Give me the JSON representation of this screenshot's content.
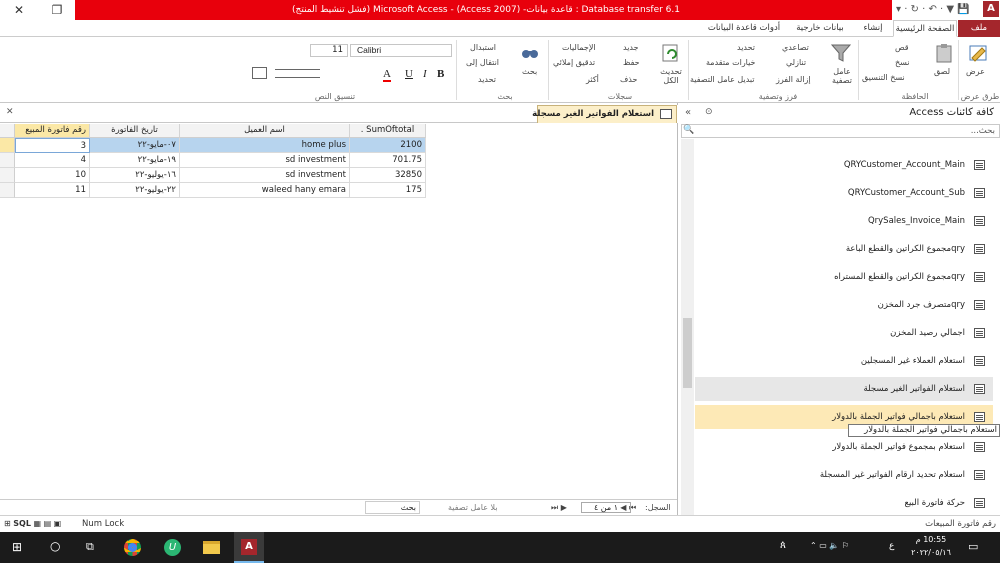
{
  "window": {
    "title": "Database transfer 6.1 : قاعدة بيانات- (Access 2007) - Microsoft Access (فشل تنشيط المنتج)"
  },
  "ribbon": {
    "tabs": [
      "ملف",
      "الصفحة الرئيسية",
      "إنشاء",
      "بيانات خارجية",
      "أدوات قاعدة البيانات"
    ],
    "views": {
      "button": "عرض",
      "group": "طرق عرض"
    },
    "clipboard": {
      "paste": "لصق",
      "cut": "قص",
      "copy": "نسخ",
      "format_painter": "نسخ التنسيق",
      "group": "الحافظة"
    },
    "sort_filter": {
      "filter": "عامل تصفية",
      "ascending": "تصاعدي",
      "descending": "تنازلي",
      "remove_sort": "إزالة الفرز",
      "selection": "تحديد",
      "advanced": "خيارات متقدمة",
      "toggle_filter": "تبديل عامل التصفية",
      "group": "فرز وتصفية"
    },
    "records": {
      "refresh_all": "تحديث الكل",
      "new": "جديد",
      "save": "حفظ",
      "delete": "حذف",
      "totals": "الإجماليات",
      "spelling": "تدقيق إملائي",
      "more": "أكثر",
      "group": "سجلات"
    },
    "find": {
      "find": "بحث",
      "replace": "استبدال",
      "goto": "انتقال إلى",
      "select": "تحديد",
      "group": "بحث"
    },
    "text_format": {
      "font": "Calibri",
      "size": "11",
      "bold": "B",
      "italic": "I",
      "underline": "U",
      "font_color": "A",
      "group": "تنسيق النص"
    }
  },
  "nav_pane": {
    "title": "كافة كائنات Access",
    "search_placeholder": "بحث...",
    "items": [
      "QRYCustomer_Account_Main",
      "QRYCustomer_Account_Sub",
      "QrySales_Invoice_Main",
      "qryمجموع الكراتين والقطع الباعة",
      "qryمجموع الكراتين والقطع المستراه",
      "qryمتصرف جرد المخزن",
      "اجمالي رصيد المخزن",
      "استعلام العملاء غير المسجلين",
      "استعلام الفواتير الغير مسجلة",
      "استعلام باجمالي فواتير الجملة بالدولار",
      "استعلام بمجموع فواتير الجملة بالدولار",
      "استعلام تحديد ارقام الفواتير غير المسجلة",
      "حركة فاتورة البيع"
    ],
    "tooltip": "استعلام باجمالي فواتير الجملة بالدولار"
  },
  "document": {
    "tab_title": "استعلام الفواتير الغير مسجلة",
    "columns": [
      "رقم فاتورة المبيع",
      "تاريخ الفاتورة",
      "اسم العميل",
      "SumOftotal ."
    ],
    "rows": [
      [
        "3",
        "٠٧-مايو-٢٢",
        "home plus",
        "2100"
      ],
      [
        "4",
        "١٩-مايو-٢٢",
        "sd investment",
        "701.75"
      ],
      [
        "10",
        "١٦-يوليو-٢٢",
        "sd investment",
        "32850"
      ],
      [
        "11",
        "٢٢-يوليو-٢٢",
        "waleed hany emara",
        "175"
      ]
    ]
  },
  "record_nav": {
    "label": "السجل:",
    "position": "١ من ٤",
    "filter": "بلا عامل تصفية",
    "search": "بحث"
  },
  "status": {
    "left": "رقم فاتورة المبيعات",
    "num_lock": "Num Lock",
    "sql": "SQL"
  },
  "taskbar": {
    "time": "10:55 م",
    "date": "٢٠٢٢/٠٥/١٦",
    "lang": "ع"
  },
  "colors": {
    "accent": "#a4262c",
    "titlebar": "#e8000c",
    "selection": "#b7d4ee",
    "active_tab": "#fcefc9"
  }
}
